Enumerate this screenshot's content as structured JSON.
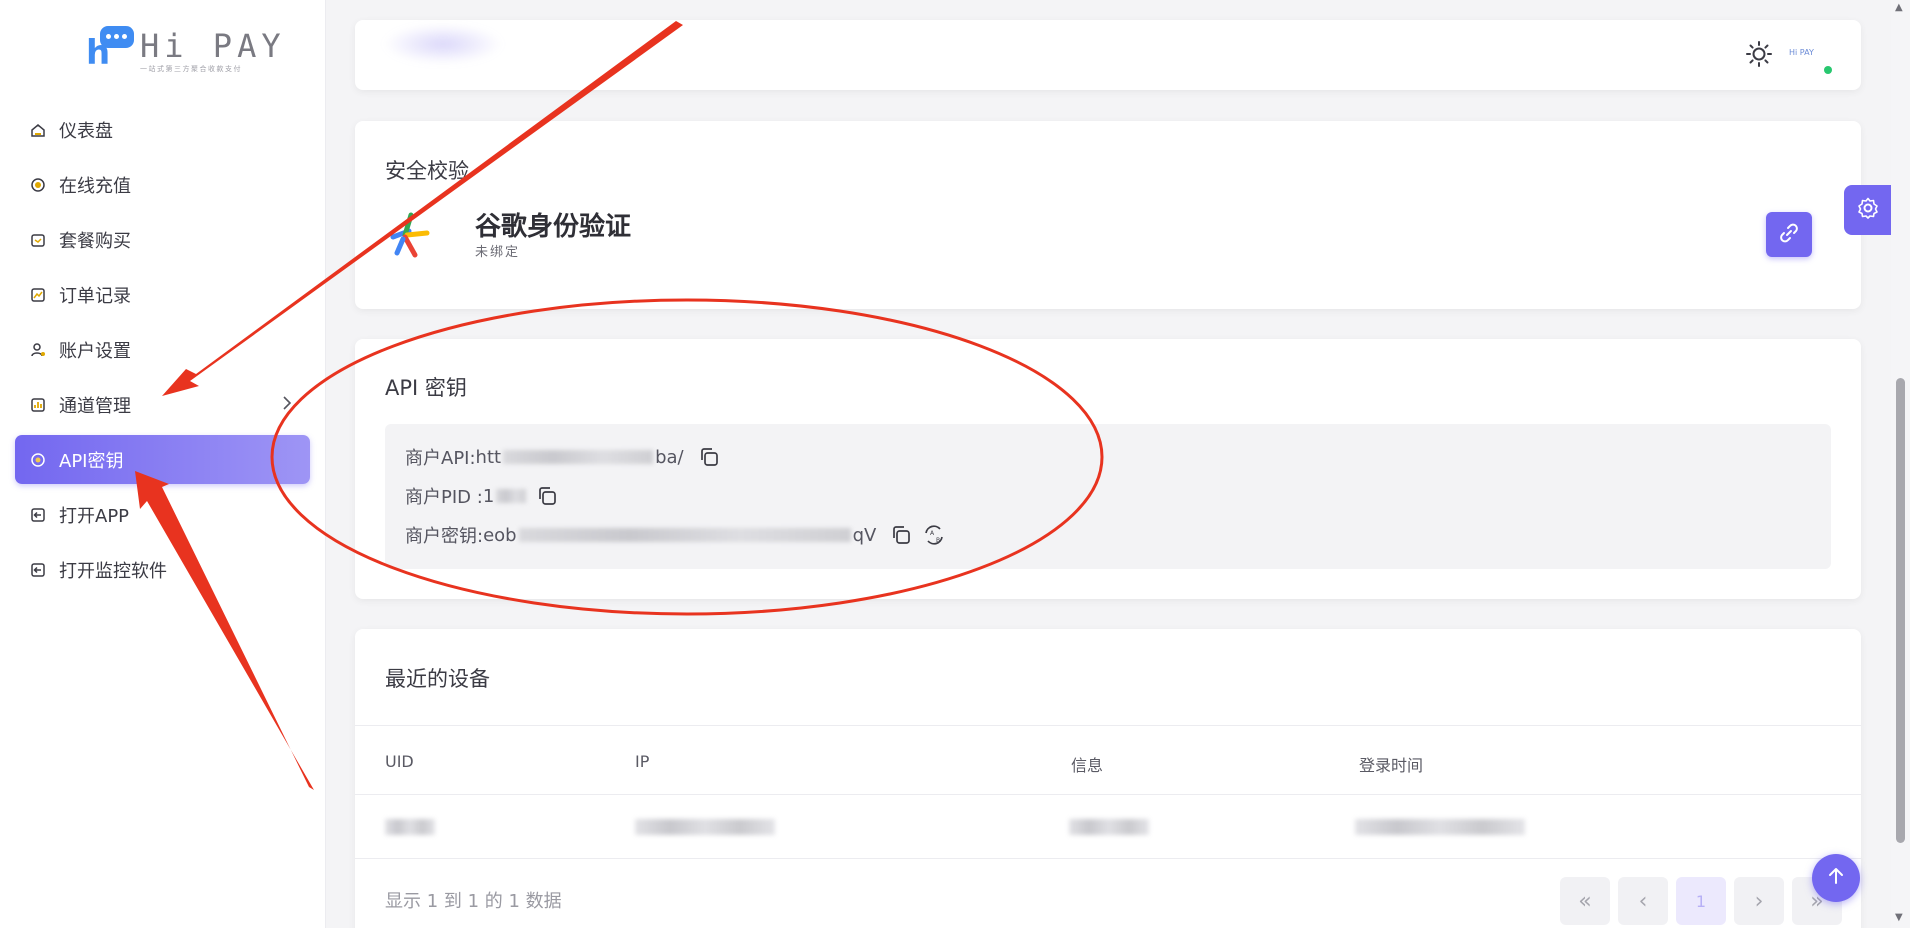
{
  "brand": {
    "name": "Hi PAY",
    "tagline": "一站式第三方聚合收款支付",
    "avatar_text": "Hi PAY"
  },
  "sidebar": {
    "items": [
      {
        "label": "仪表盘",
        "icon": "dashboard-icon"
      },
      {
        "label": "在线充值",
        "icon": "coin-icon"
      },
      {
        "label": "套餐购买",
        "icon": "package-icon"
      },
      {
        "label": "订单记录",
        "icon": "chart-icon"
      },
      {
        "label": "账户设置",
        "icon": "user-settings-icon"
      },
      {
        "label": "通道管理",
        "icon": "bar-chart-icon",
        "has_submenu": true
      },
      {
        "label": "API密钥",
        "icon": "key-icon",
        "active": true
      },
      {
        "label": "打开APP",
        "icon": "open-app-icon"
      },
      {
        "label": "打开监控软件",
        "icon": "open-monitor-icon"
      }
    ]
  },
  "security": {
    "title": "安全校验",
    "google_auth": {
      "title": "谷歌身份验证",
      "status": "未绑定"
    }
  },
  "api_keys": {
    "title": "API 密钥",
    "merchant_api": {
      "label": "商户API: ",
      "value_start": "htt",
      "value_end": "ba/"
    },
    "merchant_pid": {
      "label": "商户PID :",
      "value_start": "1"
    },
    "merchant_secret": {
      "label": "商户密钥: ",
      "value_start": "eob",
      "value_end": "qV"
    }
  },
  "devices": {
    "title": "最近的设备",
    "columns": [
      "UID",
      "IP",
      "信息",
      "登录时间"
    ],
    "footer": "显示 1 到 1 的 1 数据",
    "pagination": {
      "first": "«",
      "prev": "‹",
      "current": "1",
      "next": "›",
      "last": "»"
    }
  },
  "colors": {
    "accent": "#7367f0",
    "annotation": "#e8331f",
    "online": "#28c76f"
  }
}
